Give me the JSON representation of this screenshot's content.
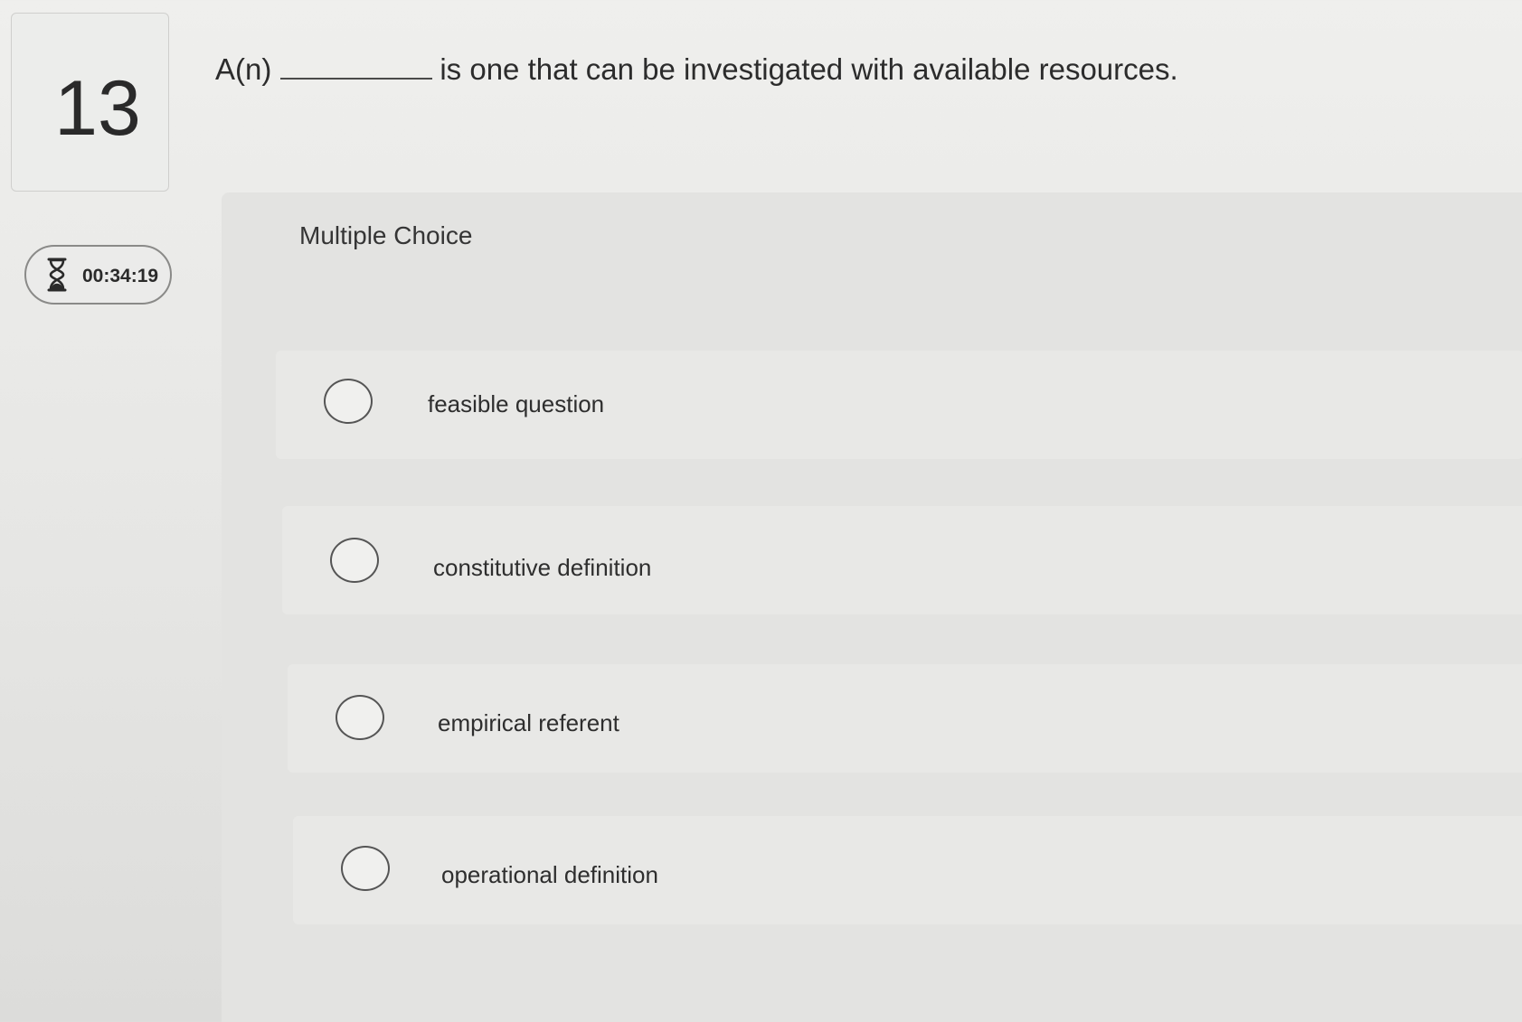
{
  "question": {
    "number": "13",
    "prefix": "A(n)",
    "suffix": "is one that can be investigated with available resources."
  },
  "timer": {
    "icon": "hourglass-icon",
    "value": "00:34:19"
  },
  "section_label": "Multiple Choice",
  "options": [
    {
      "label": "feasible question"
    },
    {
      "label": "constitutive definition"
    },
    {
      "label": "empirical referent"
    },
    {
      "label": "operational definition"
    }
  ]
}
